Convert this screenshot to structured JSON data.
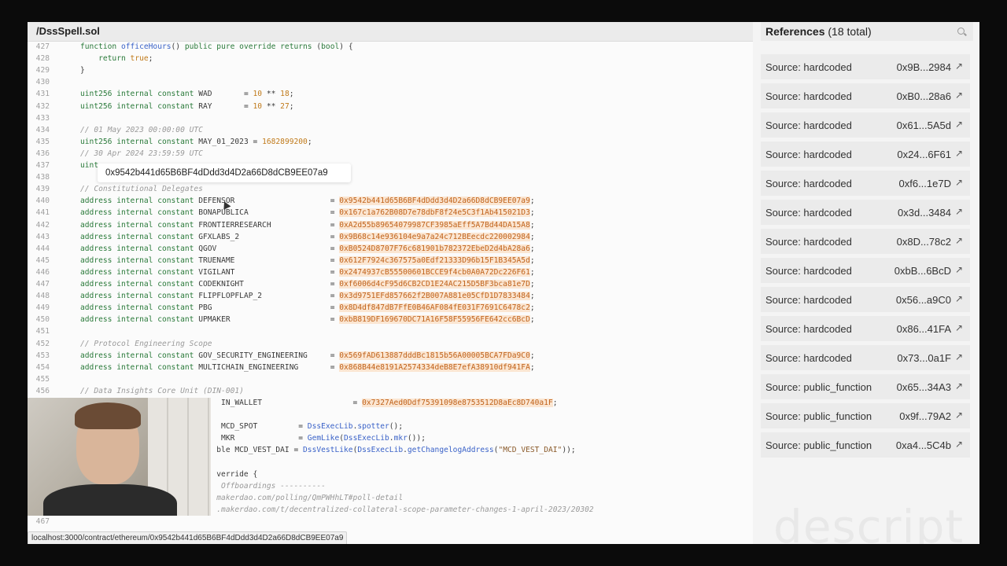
{
  "file": {
    "title": "/DssSpell.sol"
  },
  "lines": [
    {
      "n": "427",
      "parts": [
        [
          "kw",
          "function "
        ],
        [
          "fn",
          "officeHours"
        ],
        [
          "",
          "() "
        ],
        [
          "kw",
          "public pure override returns "
        ],
        [
          "",
          "("
        ],
        [
          "kw",
          "bool"
        ],
        [
          "",
          ") {"
        ]
      ]
    },
    {
      "n": "428",
      "parts": [
        [
          "",
          "    "
        ],
        [
          "kw",
          "return "
        ],
        [
          "num",
          "true"
        ],
        [
          "",
          ";"
        ]
      ]
    },
    {
      "n": "429",
      "parts": [
        [
          "",
          "}"
        ]
      ]
    },
    {
      "n": "430",
      "parts": []
    },
    {
      "n": "431",
      "parts": [
        [
          "kw",
          "uint256 internal constant "
        ],
        [
          "",
          "WAD       = "
        ],
        [
          "num",
          "10"
        ],
        [
          "",
          " ** "
        ],
        [
          "num",
          "18"
        ],
        [
          "",
          ";"
        ]
      ]
    },
    {
      "n": "432",
      "parts": [
        [
          "kw",
          "uint256 internal constant "
        ],
        [
          "",
          "RAY       = "
        ],
        [
          "num",
          "10"
        ],
        [
          "",
          " ** "
        ],
        [
          "num",
          "27"
        ],
        [
          "",
          ";"
        ]
      ]
    },
    {
      "n": "433",
      "parts": []
    },
    {
      "n": "434",
      "parts": [
        [
          "cm",
          "// 01 May 2023 00:00:00 UTC"
        ]
      ]
    },
    {
      "n": "435",
      "parts": [
        [
          "kw",
          "uint256 internal constant "
        ],
        [
          "",
          "MAY_01_2023 = "
        ],
        [
          "num",
          "1682899200"
        ],
        [
          "",
          ";"
        ]
      ]
    },
    {
      "n": "436",
      "parts": [
        [
          "cm",
          "// 30 Apr 2024 23:59:59 UTC"
        ]
      ]
    },
    {
      "n": "437",
      "parts": [
        [
          "kw",
          "uint"
        ]
      ]
    },
    {
      "n": "438",
      "parts": []
    },
    {
      "n": "439",
      "parts": [
        [
          "cm",
          "// Constitutional Delegates"
        ]
      ]
    },
    {
      "n": "440",
      "parts": [
        [
          "kw",
          "address internal constant "
        ],
        [
          "",
          "DEFENSOR                     = "
        ],
        [
          "addr",
          "0x9542b441d65B6BF4dDdd3d4D2a66D8dCB9EE07a9"
        ],
        [
          "",
          ";"
        ]
      ]
    },
    {
      "n": "441",
      "parts": [
        [
          "kw",
          "address internal constant "
        ],
        [
          "",
          "BONAPUBLICA                  = "
        ],
        [
          "addr",
          "0x167c1a762B08D7e78dbF8f24e5C3f1Ab415021D3"
        ],
        [
          "",
          ";"
        ]
      ]
    },
    {
      "n": "442",
      "parts": [
        [
          "kw",
          "address internal constant "
        ],
        [
          "",
          "FRONTIERRESEARCH             = "
        ],
        [
          "addr",
          "0xA2d55b89654079987CF3985aEff5A7Bd44DA15A8"
        ],
        [
          "",
          ";"
        ]
      ]
    },
    {
      "n": "443",
      "parts": [
        [
          "kw",
          "address internal constant "
        ],
        [
          "",
          "GFXLABS_2                    = "
        ],
        [
          "addr",
          "0x9B68c14e936104e9a7a24c712BEecdc220002984"
        ],
        [
          "",
          ";"
        ]
      ]
    },
    {
      "n": "444",
      "parts": [
        [
          "kw",
          "address internal constant "
        ],
        [
          "",
          "QGOV                         = "
        ],
        [
          "addr",
          "0xB0524D8707F76c681901b782372EbeD2d4bA28a6"
        ],
        [
          "",
          ";"
        ]
      ]
    },
    {
      "n": "445",
      "parts": [
        [
          "kw",
          "address internal constant "
        ],
        [
          "",
          "TRUENAME                     = "
        ],
        [
          "addr",
          "0x612F7924c367575a0Edf21333D96b15F1B345A5d"
        ],
        [
          "",
          ";"
        ]
      ]
    },
    {
      "n": "446",
      "parts": [
        [
          "kw",
          "address internal constant "
        ],
        [
          "",
          "VIGILANT                     = "
        ],
        [
          "addr",
          "0x2474937cB55500601BCCE9f4cb0A0A72Dc226F61"
        ],
        [
          "",
          ";"
        ]
      ]
    },
    {
      "n": "447",
      "parts": [
        [
          "kw",
          "address internal constant "
        ],
        [
          "",
          "CODEKNIGHT                   = "
        ],
        [
          "addr",
          "0xf6006d4cF95d6CB2CD1E24AC215D5BF3bca81e7D"
        ],
        [
          "",
          ";"
        ]
      ]
    },
    {
      "n": "448",
      "parts": [
        [
          "kw",
          "address internal constant "
        ],
        [
          "",
          "FLIPFLOPFLAP_2               = "
        ],
        [
          "addr",
          "0x3d9751EFd857662f2B007A881e05CfD1D7833484"
        ],
        [
          "",
          ";"
        ]
      ]
    },
    {
      "n": "449",
      "parts": [
        [
          "kw",
          "address internal constant "
        ],
        [
          "",
          "PBG                          = "
        ],
        [
          "addr",
          "0x8D4df847dB7FfE0B46AF084fE031F7691C6478c2"
        ],
        [
          "",
          ";"
        ]
      ]
    },
    {
      "n": "450",
      "parts": [
        [
          "kw",
          "address internal constant "
        ],
        [
          "",
          "UPMAKER                      = "
        ],
        [
          "addr",
          "0xbB819DF169670DC71A16F58F55956FE642cc6BcD"
        ],
        [
          "",
          ";"
        ]
      ]
    },
    {
      "n": "451",
      "parts": []
    },
    {
      "n": "452",
      "parts": [
        [
          "cm",
          "// Protocol Engineering Scope"
        ]
      ]
    },
    {
      "n": "453",
      "parts": [
        [
          "kw",
          "address internal constant "
        ],
        [
          "",
          "GOV_SECURITY_ENGINEERING     = "
        ],
        [
          "addr",
          "0x569fAD613887dddBc1815b56A00005BCA7FDa9C0"
        ],
        [
          "",
          ";"
        ]
      ]
    },
    {
      "n": "454",
      "parts": [
        [
          "kw",
          "address internal constant "
        ],
        [
          "",
          "MULTICHAIN_ENGINEERING       = "
        ],
        [
          "addr",
          "0x868B44e8191A2574334deB8E7efA38910df941FA"
        ],
        [
          "",
          ";"
        ]
      ]
    },
    {
      "n": "455",
      "parts": []
    },
    {
      "n": "456",
      "parts": [
        [
          "cm",
          "// Data Insights Core Unit (DIN-001)"
        ]
      ]
    },
    {
      "n": "",
      "parts": [
        [
          "",
          "                               IN_WALLET                    = "
        ],
        [
          "addr",
          "0x7327Aed0Ddf75391098e8753512D8aEc8D740a1F"
        ],
        [
          "",
          ";"
        ]
      ]
    },
    {
      "n": "",
      "parts": []
    },
    {
      "n": "",
      "parts": [
        [
          "",
          "                               MCD_SPOT         = "
        ],
        [
          "fn",
          "DssExecLib"
        ],
        [
          "",
          "."
        ],
        [
          "fn",
          "spotter"
        ],
        [
          "",
          "();"
        ]
      ]
    },
    {
      "n": "",
      "parts": [
        [
          "",
          "                               MKR              = "
        ],
        [
          "fn",
          "GemLike"
        ],
        [
          "",
          "("
        ],
        [
          "fn",
          "DssExecLib"
        ],
        [
          "",
          "."
        ],
        [
          "fn",
          "mkr"
        ],
        [
          "",
          "());"
        ]
      ]
    },
    {
      "n": "",
      "parts": [
        [
          "",
          "                              ble MCD_VEST_DAI = "
        ],
        [
          "fn",
          "DssVestLike"
        ],
        [
          "",
          "("
        ],
        [
          "fn",
          "DssExecLib"
        ],
        [
          "",
          "."
        ],
        [
          "fn",
          "getChangelogAddress"
        ],
        [
          "",
          "("
        ],
        [
          "str",
          "\"MCD_VEST_DAI\""
        ],
        [
          "",
          "));"
        ]
      ]
    },
    {
      "n": "",
      "parts": []
    },
    {
      "n": "",
      "parts": [
        [
          "",
          "                              verride {"
        ]
      ]
    },
    {
      "n": "",
      "parts": [
        [
          "cm",
          "                               Offboardings ----------"
        ]
      ]
    },
    {
      "n": "",
      "parts": [
        [
          "cm",
          "                              makerdao.com/polling/QmPWHhLT#poll-detail"
        ]
      ]
    },
    {
      "n": "",
      "parts": [
        [
          "cm",
          "                              .makerdao.com/t/decentralized-collateral-scope-parameter-changes-1-april-2023/20302"
        ]
      ]
    },
    {
      "n": "467",
      "parts": []
    }
  ],
  "tooltip": {
    "text": "0x9542b441d65B6BF4dDdd3d4D2a66D8dCB9EE07a9"
  },
  "status_bar": {
    "url": "localhost:3000/contract/ethereum/0x9542b441d65B6BF4dDdd3d4D2a66D8dCB9EE07a9"
  },
  "references": {
    "title": "References",
    "count": "(18 total)",
    "items": [
      {
        "source": "Source: hardcoded",
        "address": "0x9B...2984"
      },
      {
        "source": "Source: hardcoded",
        "address": "0xB0...28a6"
      },
      {
        "source": "Source: hardcoded",
        "address": "0x61...5A5d"
      },
      {
        "source": "Source: hardcoded",
        "address": "0x24...6F61"
      },
      {
        "source": "Source: hardcoded",
        "address": "0xf6...1e7D"
      },
      {
        "source": "Source: hardcoded",
        "address": "0x3d...3484"
      },
      {
        "source": "Source: hardcoded",
        "address": "0x8D...78c2"
      },
      {
        "source": "Source: hardcoded",
        "address": "0xbB...6BcD"
      },
      {
        "source": "Source: hardcoded",
        "address": "0x56...a9C0"
      },
      {
        "source": "Source: hardcoded",
        "address": "0x86...41FA"
      },
      {
        "source": "Source: hardcoded",
        "address": "0x73...0a1F"
      },
      {
        "source": "Source: public_function",
        "address": "0x65...34A3"
      },
      {
        "source": "Source: public_function",
        "address": "0x9f...79A2"
      },
      {
        "source": "Source: public_function",
        "address": "0xa4...5C4b"
      }
    ]
  },
  "watermark": {
    "text": "descript"
  },
  "icons": {
    "search": "search-icon",
    "external_link": "external-link-icon"
  }
}
